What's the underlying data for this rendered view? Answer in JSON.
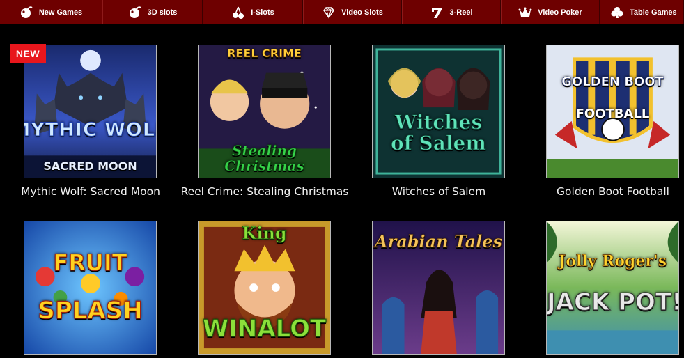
{
  "nav": {
    "items": [
      {
        "label": "New Games",
        "icon": "cherry-bomb-icon"
      },
      {
        "label": "3D slots",
        "icon": "cherry-bomb-icon"
      },
      {
        "label": "I-Slots",
        "icon": "cherry-icon"
      },
      {
        "label": "Video Slots",
        "icon": "diamond-icon"
      },
      {
        "label": "3-Reel",
        "icon": "seven-icon"
      },
      {
        "label": "Video Poker",
        "icon": "crown-icon"
      },
      {
        "label": "Table Games",
        "icon": "club-icon"
      }
    ]
  },
  "badge": {
    "new": "NEW"
  },
  "games": [
    {
      "caption": "Mythic Wolf: Sacred Moon",
      "art_title": "MYTHIC WOLF",
      "art_sub": "SACRED MOON",
      "bg": "#2a3d8f"
    },
    {
      "caption": "Reel Crime: Stealing Christmas",
      "art_title": "REEL CRIME",
      "art_sub": "Stealing Christmas",
      "bg": "#2a2048"
    },
    {
      "caption": "Witches of Salem",
      "art_title": "",
      "art_sub": "Witches of Salem",
      "bg": "#0f3a3a"
    },
    {
      "caption": "Golden Boot Football",
      "art_title": "GOLDEN BOOT",
      "art_sub": "FOOTBALL",
      "bg": "#1d2f72"
    },
    {
      "caption": "",
      "art_title": "FRUIT",
      "art_sub": "SPLASH",
      "bg": "#1b63c4"
    },
    {
      "caption": "",
      "art_title": "King",
      "art_sub": "WINALOT",
      "bg": "#b8860b"
    },
    {
      "caption": "",
      "art_title": "Arabian Tales",
      "art_sub": "",
      "bg": "#2b1b5c"
    },
    {
      "caption": "",
      "art_title": "Jolly Roger's",
      "art_sub": "JACK POT!",
      "bg": "#3f7a3a"
    }
  ],
  "colors": {
    "nav_bg": "#6e0000",
    "badge": "#e8161c",
    "page_bg": "#000000"
  }
}
